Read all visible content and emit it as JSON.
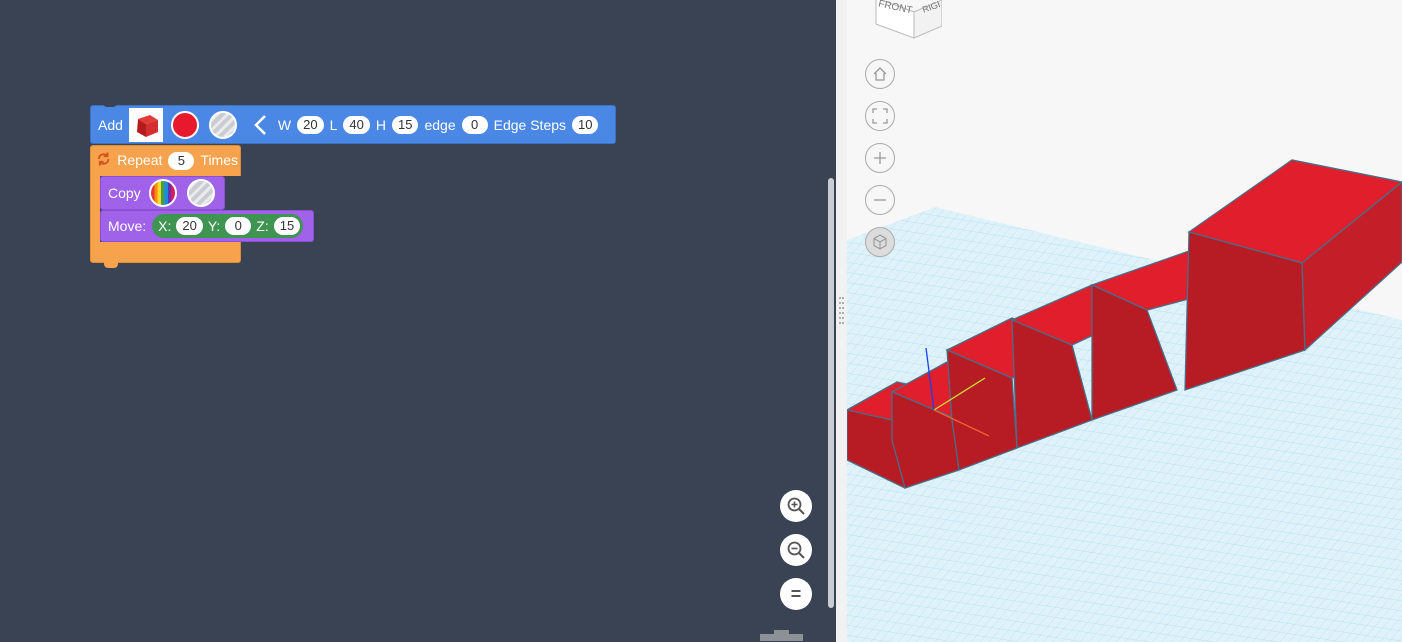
{
  "blocks": {
    "add": {
      "label": "Add",
      "w_label": "W",
      "w": "20",
      "l_label": "L",
      "l": "40",
      "h_label": "H",
      "h": "15",
      "edge_label": "edge",
      "edge": "0",
      "steps_label": "Edge Steps",
      "steps": "10"
    },
    "repeat": {
      "label": "Repeat",
      "count": "5",
      "suffix": "Times"
    },
    "copy": {
      "label": "Copy"
    },
    "move": {
      "label": "Move:",
      "x_label": "X:",
      "x": "20",
      "y_label": "Y:",
      "y": "0",
      "z_label": "Z:",
      "z": "15"
    }
  },
  "viewcube": {
    "front": "FRONT",
    "right": "RIGHT"
  },
  "colors": {
    "workspace": "#394353",
    "add_block": "#4b88e5",
    "repeat_block": "#f7a24d",
    "copy_block": "#9f62e8",
    "shape": "#e01e2c",
    "grid": "#a8dcef"
  },
  "zoom_controls": {
    "reset_label": "="
  }
}
